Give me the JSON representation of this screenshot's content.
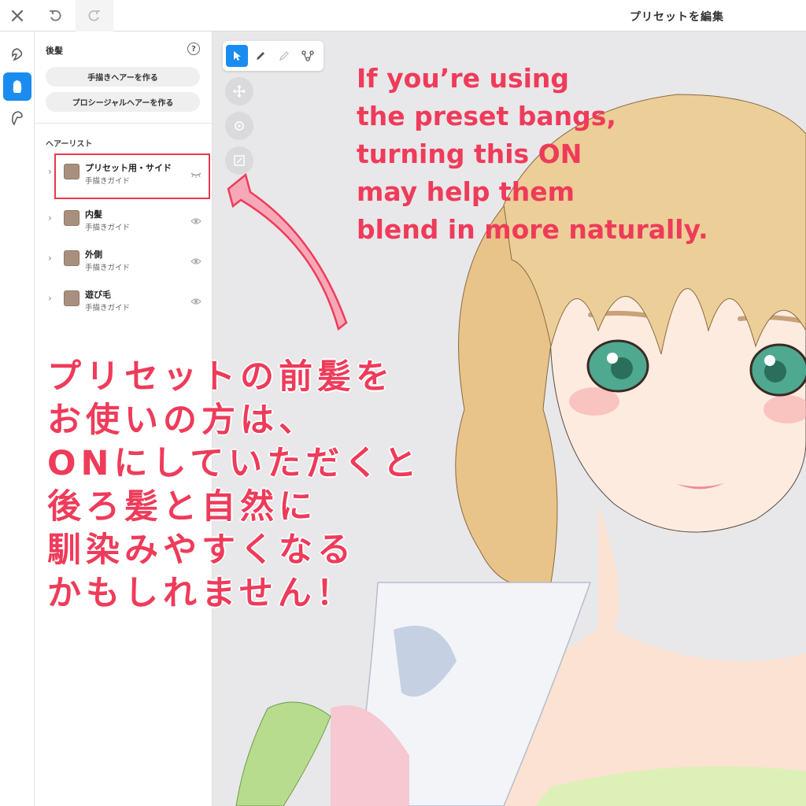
{
  "topbar": {
    "title": "プリセットを編集",
    "close_icon": "close-icon",
    "undo_icon": "undo-icon",
    "redo_icon": "redo-icon"
  },
  "rail": {
    "items": [
      {
        "icon": "front-hair-icon",
        "active": false
      },
      {
        "icon": "back-hair-icon",
        "active": true
      },
      {
        "icon": "side-hair-icon",
        "active": false
      }
    ]
  },
  "panel": {
    "title": "後髪",
    "help_icon": "?",
    "buttons": [
      "手描きヘアーを作る",
      "プロシージャルヘアーを作る"
    ],
    "list_heading": "ヘアーリスト",
    "hair_list": [
      {
        "name": "プリセット用・サイド",
        "sub": "手描きガイド",
        "visible": false
      },
      {
        "name": "内髪",
        "sub": "手描きガイド",
        "visible": true
      },
      {
        "name": "外側",
        "sub": "手描きガイド",
        "visible": true
      },
      {
        "name": "遊び毛",
        "sub": "手描きガイド",
        "visible": true
      }
    ],
    "swatch_color": "#a9907e"
  },
  "canvas": {
    "tools": [
      "select-icon",
      "pen-icon",
      "eraser-icon",
      "path-icon"
    ],
    "round_tools": [
      "move-icon",
      "rotate-icon",
      "scale-icon"
    ]
  },
  "annotation": {
    "en_lines": [
      "If you’re using",
      "the preset bangs,",
      "turning this ON",
      "may help them",
      "blend in more naturally."
    ],
    "jp_lines": [
      "プリセットの前髪を",
      "お使いの方は、",
      "ONにしていただくと",
      "後ろ髪と自然に",
      "馴染みやすくなる",
      "かもしれません！"
    ],
    "color": "#ef3b5a"
  },
  "colors": {
    "accent": "#1a8cf0",
    "highlight": "#e8384f"
  }
}
